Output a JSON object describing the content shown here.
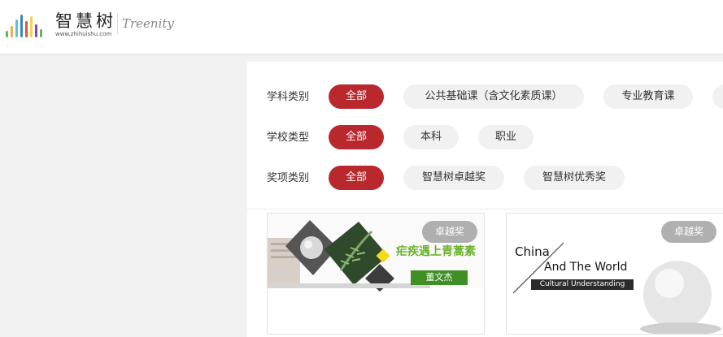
{
  "header": {
    "logo_cn": "智慧树",
    "logo_url": "www.zhihuishu.com",
    "logo_en": "Treenity",
    "logo_bar_colors": [
      "#5cb85c",
      "#f0ad4e",
      "#5bc0de",
      "#3a87ad",
      "#d9534f",
      "#f7d34a",
      "#8e44ad",
      "#5cb85c"
    ]
  },
  "filters": [
    {
      "label": "学科类别",
      "options": [
        "全部",
        "公共基础课（含文化素质课）",
        "专业教育课"
      ],
      "active": 0
    },
    {
      "label": "学校类型",
      "options": [
        "全部",
        "本科",
        "职业"
      ],
      "active": 0
    },
    {
      "label": "奖项类别",
      "options": [
        "全部",
        "智慧树卓越奖",
        "智慧树优秀奖"
      ],
      "active": 0
    }
  ],
  "cards": [
    {
      "badge": "卓越奖",
      "title": "疟疾遇上青蒿素",
      "author": "董文杰"
    },
    {
      "badge": "卓越奖",
      "title_line1": "China",
      "title_line2": "And The World",
      "subtitle": "Cultural Understanding"
    }
  ],
  "colors": {
    "accent": "#b8282d",
    "chip_bg": "#f1f1f1",
    "page_bg": "#f2f2f2"
  }
}
